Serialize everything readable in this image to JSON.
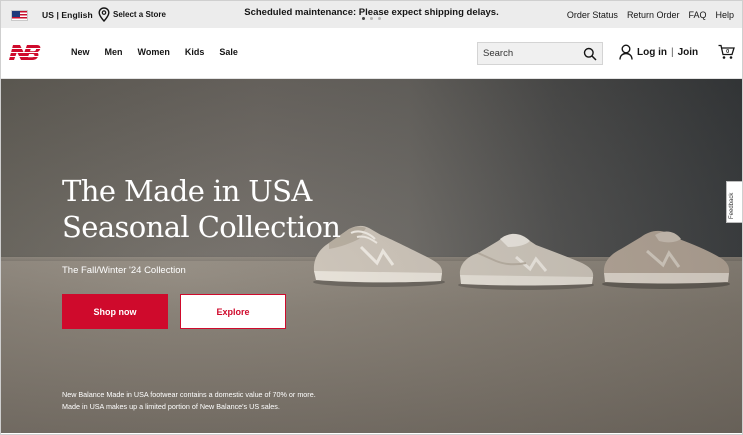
{
  "utility_bar": {
    "locale": "US | English",
    "store_locator": "Select a Store",
    "announcement": "Scheduled maintenance: Please expect shipping delays.",
    "carousel_dots": 3,
    "carousel_active": 1,
    "links": [
      "Order Status",
      "Return Order",
      "FAQ",
      "Help"
    ]
  },
  "header": {
    "logo_icon": "new-balance-logo",
    "nav": [
      "New",
      "Men",
      "Women",
      "Kids",
      "Sale"
    ],
    "search_placeholder": "Search",
    "login": "Log in",
    "join": "Join",
    "cart_count": "0"
  },
  "hero": {
    "title_line1": "The Made in USA",
    "title_line2": "Seasonal Collection",
    "subtitle": "The Fall/Winter '24 Collection",
    "shop_button": "Shop now",
    "explore_button": "Explore",
    "disclaimer": "New Balance Made in USA footwear contains a domestic value of 70% or more. Made in USA makes up a limited portion of New Balance's US sales."
  },
  "feedback_tab": "Feedback",
  "colors": {
    "brand_red": "#cf0a2c",
    "utility_bg": "#ececec"
  }
}
